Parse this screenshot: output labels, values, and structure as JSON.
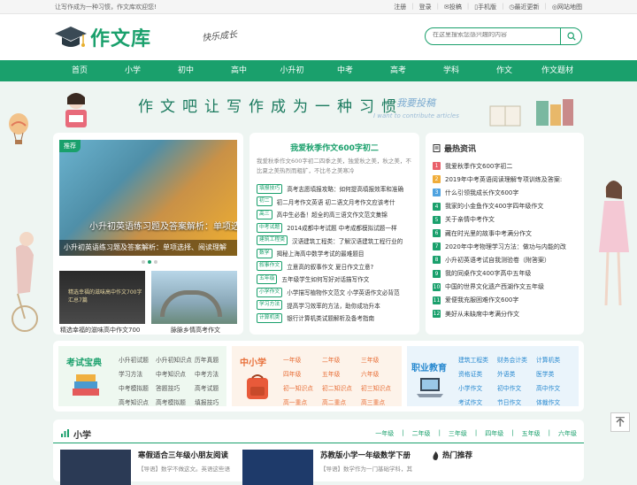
{
  "topbar": {
    "welcome": "让写作成为一种习惯，作文库欢迎您!",
    "links": [
      "注册",
      "登录",
      "投稿",
      "手机版",
      "最近更新",
      "网站地图"
    ]
  },
  "header": {
    "logo_text": "作文库",
    "slogan": "快乐成长",
    "search_placeholder": "在这里搜索您感兴趣的内容"
  },
  "nav": [
    "首页",
    "小学",
    "初中",
    "高中",
    "小升初",
    "中考",
    "高考",
    "学科",
    "作文",
    "作文题材"
  ],
  "banner": {
    "slogan": "作文吧让写作成为一种习惯",
    "contribute": "我要投稿",
    "contribute_en": "I want to contribute articles"
  },
  "slider": {
    "badge": "推荐",
    "headline": "小升初英语练习题及答案解析：单项选择、阅读",
    "caption": "小升初英语练习题及答案解析：单项选择、阅读理解",
    "thumbs": [
      {
        "caption": "精选幸福的滋味高中作文700",
        "inner": "精选幸福的滋味高中作文700字汇总7篇"
      },
      {
        "caption": "脉脉乡情高考作文"
      }
    ]
  },
  "featured": {
    "title": "我爱秋季作文600字初二",
    "intro": "我爱秋季作文600字初二四季之美，独爱秋之美，秋之美，不比夏之美热烈而粗犷，不比冬之美寒冷",
    "rows": [
      {
        "tag": "填报技巧",
        "text": "高考志愿填报攻略：如何提高填报效率和准确"
      },
      {
        "tag": "初二",
        "text": "初二月考作文英语 初二语文月考作文应该考什"
      },
      {
        "tag": "高三",
        "text": "高中生必备！超全的高三语文作文范文集锦"
      },
      {
        "tag": "中考试题",
        "text": "2014成都中考试题 中考成都模拟试题一样"
      },
      {
        "tag": "建筑工程类",
        "text": "汉语建筑工程类：了解汉语建筑工程行业的"
      },
      {
        "tag": "数学",
        "text": "揭秘上海高中数学考试的最难题目"
      },
      {
        "tag": "叙事作文",
        "text": "立意高的叙事作文 夏日作文立意?"
      },
      {
        "tag": "五年级",
        "text": "五年级学生如何写好对话描写作文"
      },
      {
        "tag": "小学作文",
        "text": "小学描写植物作文范文 小学英语作文必背范"
      },
      {
        "tag": "学习方法",
        "text": "提高学习效率的方法，助你成功升本"
      },
      {
        "tag": "计算机类",
        "text": "银行计算机类试题解析及备考指南"
      }
    ]
  },
  "latest": {
    "title": "最热资讯",
    "items": [
      "我爱秋季作文600字初二",
      "2019年中考英语阅读理解专项训练及答案:",
      "什么引领我成长作文600字",
      "我家的小金鱼作文400字四年级作文",
      "关于亲情中考作文",
      "藏在时光里的故事中考满分作文",
      "2020年中考物理学习方法：做功与内能的改",
      "小升初英语考试自我测验卷（附答案）",
      "我的同桌作文400字高中五年级",
      "中国的世界文化遗产西湖作文五年级",
      "爱便我充服困难作文600字",
      "美好从未缺席中考满分作文"
    ]
  },
  "categories": {
    "exam": {
      "title": "考试宝典",
      "links": [
        "小升初试题",
        "小升初知识点",
        "历年真题",
        "学习方法",
        "中考知识点",
        "中考方法",
        "中考模拟题",
        "答题技巧",
        "高考试题",
        "高考知识点",
        "高考模拟题",
        "填报技巧"
      ]
    },
    "school": {
      "title": "中小学",
      "links": [
        "一年级",
        "二年级",
        "三年级",
        "四年级",
        "五年级",
        "六年级",
        "初一知识点",
        "初二知识点",
        "初三知识点",
        "高一重点",
        "高二重点",
        "高三重点"
      ]
    },
    "career": {
      "title": "职业教育",
      "links": [
        "建筑工程类",
        "财务会计类",
        "计算机类",
        "资格证类",
        "外语类",
        "医学类",
        "小学作文",
        "初中作文",
        "高中作文",
        "考试作文",
        "节日作文",
        "体裁作文"
      ]
    }
  },
  "section": {
    "title": "小学",
    "grades": [
      "一年级",
      "二年级",
      "三年级",
      "四年级",
      "五年级",
      "六年级"
    ],
    "articles": [
      {
        "title": "寒假适合三年级小朋友阅读",
        "desc": "【导语】数学不做这文。英语这些语"
      },
      {
        "title": "苏教版小学一年级数学下册",
        "desc": "【导语】数学作为一门基础学科，其"
      }
    ],
    "hot_title": "热门推荐"
  },
  "colors": {
    "brand": "#1aa06c",
    "num_top": "#e9606a",
    "num_mid": "#f0ad3a",
    "num_rest": "#1aa06c"
  }
}
